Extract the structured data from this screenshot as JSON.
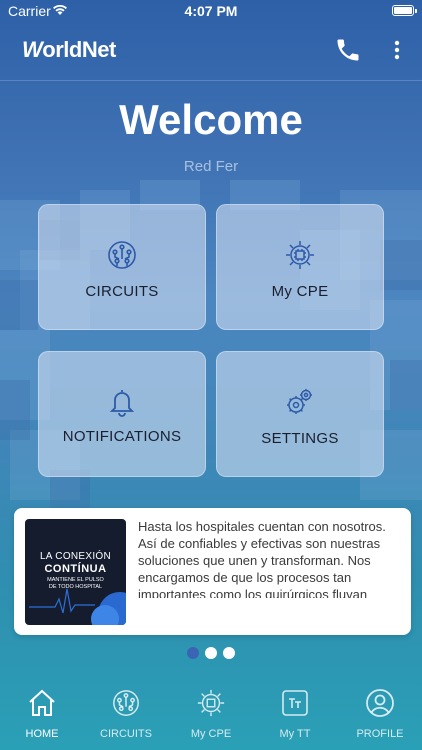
{
  "status_bar": {
    "carrier": "Carrier",
    "time": "4:07 PM"
  },
  "header": {
    "logo_part1": "W",
    "logo_part2": "orld",
    "logo_part3": "Net",
    "phone_icon": "phone-icon",
    "menu_icon": "more-vertical-icon"
  },
  "welcome": {
    "title": "Welcome",
    "user": "Red Fer"
  },
  "tiles": [
    {
      "label": "CIRCUITS",
      "icon": "circuit-icon"
    },
    {
      "label": "My CPE",
      "icon": "cpu-gear-icon"
    },
    {
      "label": "NOTIFICATIONS",
      "icon": "bell-icon"
    },
    {
      "label": "SETTINGS",
      "icon": "gears-icon"
    }
  ],
  "news": {
    "thumb_line1": "LA CONEXIÓN",
    "thumb_line2": "CONTÍNUA",
    "thumb_line3": "MANTIENE EL PULSO\nDE TODO HOSPITAL",
    "text": "Hasta los hospitales cuentan con nosotros. Así de confiables y efectivas son nuestras soluciones que unen y transforman. Nos encargamos de que los procesos tan importantes como los quirúrgicos fluyan"
  },
  "carousel": {
    "pages": 3,
    "active": 0
  },
  "nav": {
    "items": [
      {
        "label": "HOME",
        "icon": "home-icon"
      },
      {
        "label": "CIRCUITS",
        "icon": "circuit-icon"
      },
      {
        "label": "My CPE",
        "icon": "cpu-gear-icon"
      },
      {
        "label": "My TT",
        "icon": "ticket-icon"
      },
      {
        "label": "PROFILE",
        "icon": "user-icon"
      }
    ],
    "active": 0
  },
  "colors": {
    "accent": "#3c64b4",
    "icon_blue": "#2d5aa8",
    "background": "#3a6db0"
  }
}
